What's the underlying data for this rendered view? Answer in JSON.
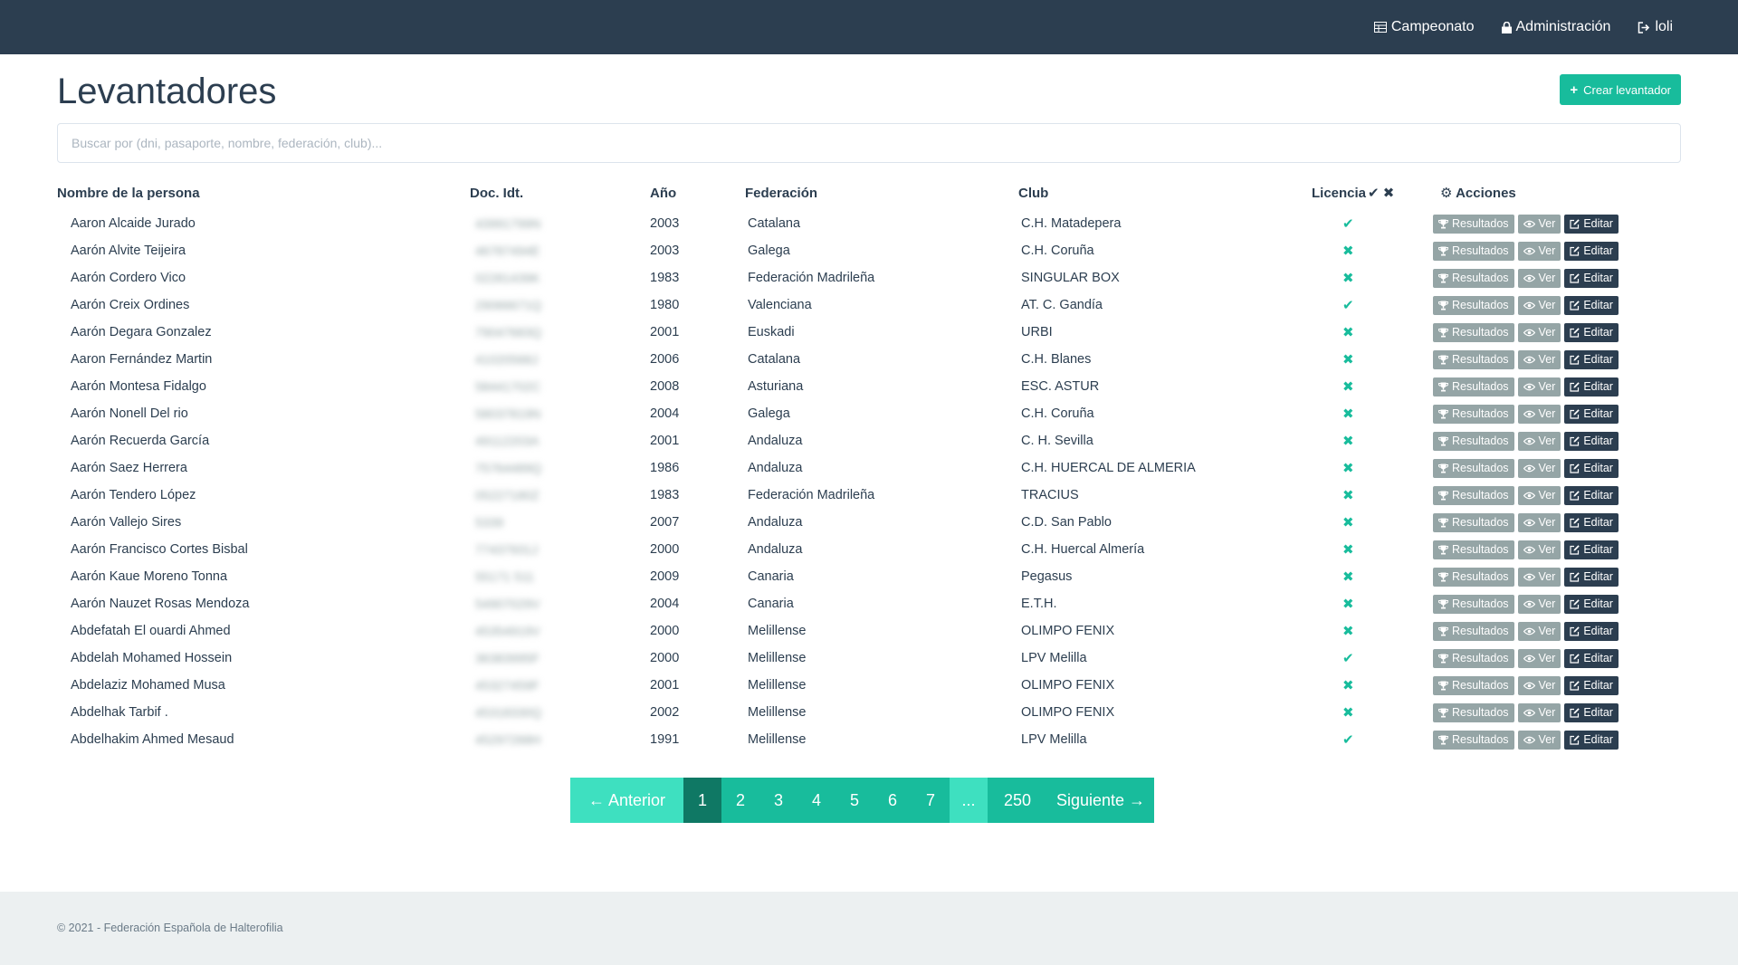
{
  "nav": {
    "items": [
      {
        "label": "Campeonato",
        "icon": "table-icon"
      },
      {
        "label": "Administración",
        "icon": "lock-icon"
      },
      {
        "label": "loli",
        "icon": "logout-icon"
      }
    ]
  },
  "page": {
    "title": "Levantadores",
    "create_button": "Crear levantador"
  },
  "search": {
    "placeholder": "Buscar por (dni, pasaporte, nombre, federación, club)..."
  },
  "table": {
    "headers": {
      "name": "Nombre de la persona",
      "doc": "Doc. Idt.",
      "year": "Año",
      "federation": "Federación",
      "club": "Club",
      "license": "Licencia",
      "actions": "Acciones"
    },
    "action_labels": {
      "results": "Resultados",
      "view": "Ver",
      "edit": "Editar"
    },
    "rows": [
      {
        "name": "Aaron Alcaide Jurado",
        "doc": "43991799N",
        "year": "2003",
        "federation": "Catalana",
        "club": "C.H. Matadepera",
        "license": true
      },
      {
        "name": "Aarón Alvite Teijeira",
        "doc": "46787494E",
        "year": "2003",
        "federation": "Galega",
        "club": "C.H. Coruña",
        "license": false
      },
      {
        "name": "Aarón Cordero Vico",
        "doc": "02281439K",
        "year": "1983",
        "federation": "Federación Madrileña",
        "club": "SINGULAR BOX",
        "license": false
      },
      {
        "name": "Aarón Creix Ordines",
        "doc": "29066671Q",
        "year": "1980",
        "federation": "Valenciana",
        "club": "AT. C. Gandía",
        "license": true
      },
      {
        "name": "Aarón Degara Gonzalez",
        "doc": "79047683Q",
        "year": "2001",
        "federation": "Euskadi",
        "club": "URBI",
        "license": false
      },
      {
        "name": "Aaron Fernández Martin",
        "doc": "41020568J",
        "year": "2006",
        "federation": "Catalana",
        "club": "C.H. Blanes",
        "license": false
      },
      {
        "name": "Aarón Montesa Fidalgo",
        "doc": "58441702C",
        "year": "2008",
        "federation": "Asturiana",
        "club": "ESC. ASTUR",
        "license": false
      },
      {
        "name": "Aarón Nonell Del rio",
        "doc": "58037819N",
        "year": "2004",
        "federation": "Galega",
        "club": "C.H. Coruña",
        "license": false
      },
      {
        "name": "Aarón Recuerda García",
        "doc": "49112203A",
        "year": "2001",
        "federation": "Andaluza",
        "club": "C. H. Sevilla",
        "license": false
      },
      {
        "name": "Aarón Saez Herrera",
        "doc": "75764489Q",
        "year": "1986",
        "federation": "Andaluza",
        "club": "C.H. HUERCAL DE ALMERIA",
        "license": false
      },
      {
        "name": "Aarón Tendero López",
        "doc": "05227180Z",
        "year": "1983",
        "federation": "Federación Madrileña",
        "club": "TRACIUS",
        "license": false
      },
      {
        "name": "Aarón Vallejo Sires",
        "doc": "5339",
        "year": "2007",
        "federation": "Andaluza",
        "club": "C.D. San Pablo",
        "license": false
      },
      {
        "name": "Aarón Francisco Cortes Bisbal",
        "doc": "77437931J",
        "year": "2000",
        "federation": "Andaluza",
        "club": "C.H. Huercal Almería",
        "license": false
      },
      {
        "name": "Aarón Kaue Moreno Tonna",
        "doc": "55171 511",
        "year": "2009",
        "federation": "Canaria",
        "club": "Pegasus",
        "license": false
      },
      {
        "name": "Aarón Nauzet Rosas Mendoza",
        "doc": "54907029V",
        "year": "2004",
        "federation": "Canaria",
        "club": "E.T.H.",
        "license": false
      },
      {
        "name": "Abdefatah El ouardi Ahmed",
        "doc": "45354919V",
        "year": "2000",
        "federation": "Melillense",
        "club": "OLIMPO FENIX",
        "license": false
      },
      {
        "name": "Abdelah Mohamed Hossein",
        "doc": "36383995F",
        "year": "2000",
        "federation": "Melillense",
        "club": "LPV Melilla",
        "license": true
      },
      {
        "name": "Abdelaziz Mohamed Musa",
        "doc": "45327459F",
        "year": "2001",
        "federation": "Melillense",
        "club": "OLIMPO FENIX",
        "license": false
      },
      {
        "name": "Abdelhak Tarbif .",
        "doc": "45318330Q",
        "year": "2002",
        "federation": "Melillense",
        "club": "OLIMPO FENIX",
        "license": false
      },
      {
        "name": "Abdelhakim Ahmed Mesaud",
        "doc": "45297268H",
        "year": "1991",
        "federation": "Melillense",
        "club": "LPV Melilla",
        "license": true
      }
    ]
  },
  "pagination": {
    "prev": "← Anterior",
    "pages": [
      "1",
      "2",
      "3",
      "4",
      "5",
      "6",
      "7"
    ],
    "active": "1",
    "dots": "...",
    "last": "250",
    "next": "Siguiente →"
  },
  "footer": {
    "text": "© 2021 - Federación Española de Halterofilia"
  },
  "colors": {
    "navbar": "#2c3e50",
    "accent": "#18bc9c",
    "active_page": "#0f7864",
    "muted_button": "#95a5a6",
    "footer_bg": "#ecf0f1"
  }
}
